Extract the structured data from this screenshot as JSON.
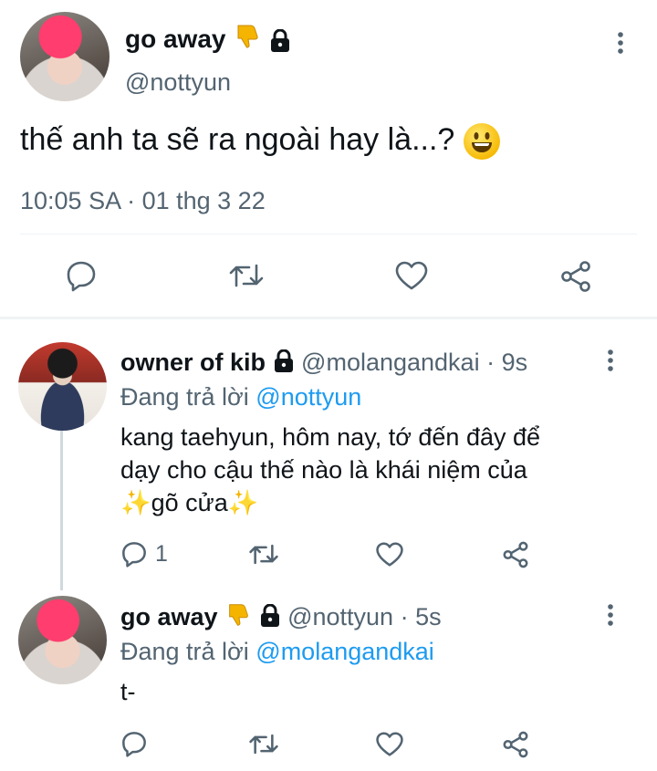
{
  "main_tweet": {
    "display_name": "go away",
    "handle": "@nottyun",
    "text": "thế anh ta sẽ ra ngoài hay là...?",
    "emoji_icon": "grinning-face-emoji",
    "timestamp": "10:05 SA · 01 thg 3 22"
  },
  "replies": [
    {
      "display_name": "owner of kib",
      "handle_time": "@molangandkai · 9s",
      "replying_prefix": "Đang trả lời",
      "replying_to": "@nottyun",
      "line1": "kang taehyun, hôm nay, tớ đến đây để",
      "line2": "dạy cho cậu thế nào là khái niệm của",
      "line3": "gõ cửa",
      "sparkle": "✨",
      "reply_count": "1"
    },
    {
      "display_name": "go away",
      "handle_time": "@nottyun · 5s",
      "replying_prefix": "Đang trả lời",
      "replying_to": "@molangandkai",
      "text": "t-"
    }
  ],
  "colors": {
    "link": "#1d9bf0",
    "muted": "#536471",
    "divider": "#eff3f4"
  }
}
